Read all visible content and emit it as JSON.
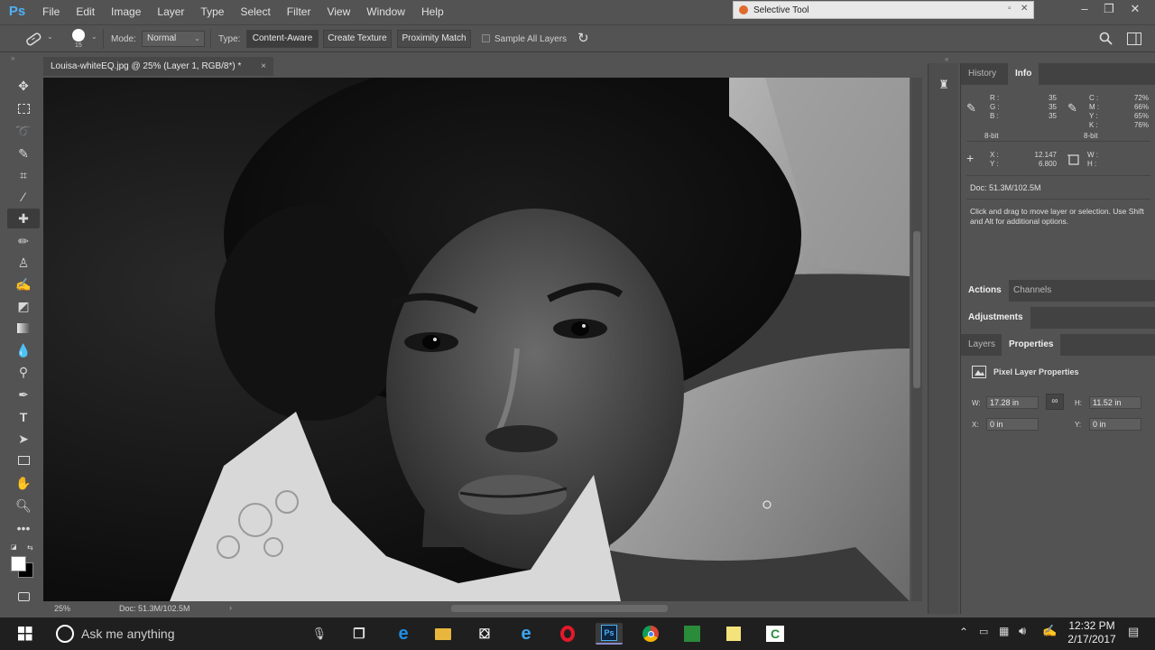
{
  "app": {
    "logo": "Ps"
  },
  "menu": [
    "File",
    "Edit",
    "Image",
    "Layer",
    "Type",
    "Select",
    "Filter",
    "View",
    "Window",
    "Help"
  ],
  "popup": {
    "title": "Selective Tool"
  },
  "options": {
    "brush_size": "15",
    "mode_label": "Mode:",
    "mode_value": "Normal",
    "type_label": "Type:",
    "type_buttons": [
      "Content-Aware",
      "Create Texture",
      "Proximity Match"
    ],
    "sample_all_layers": "Sample All Layers"
  },
  "document": {
    "tab_title": "Louisa-whiteEQ.jpg @ 25% (Layer 1, RGB/8*) *",
    "zoom": "25%",
    "doc_size": "Doc: 51.3M/102.5M"
  },
  "info_panel": {
    "tabs": [
      "History",
      "Info"
    ],
    "rgb_labels": [
      "R :",
      "G :",
      "B :"
    ],
    "rgb_values": [
      "35",
      "35",
      "35"
    ],
    "cmyk_labels": [
      "C :",
      "M :",
      "Y :",
      "K :"
    ],
    "cmyk_values": [
      "72%",
      "66%",
      "65%",
      "76%"
    ],
    "bit_depth": "8-bit",
    "bit_depth_2": "8-bit",
    "x_label": "X :",
    "y_label": "Y :",
    "x_value": "12.147",
    "y_value": "6.800",
    "w_label": "W :",
    "h_label": "H :",
    "doc_size": "Doc: 51.3M/102.5M",
    "hint": "Click and drag to move layer or selection. Use Shift and Alt for additional options."
  },
  "actions_panel": {
    "tabs": [
      "Actions",
      "Channels"
    ]
  },
  "adjustments_panel": {
    "tabs": [
      "Adjustments"
    ]
  },
  "properties_panel": {
    "tabs": [
      "Layers",
      "Properties"
    ],
    "title": "Pixel Layer Properties",
    "w_label": "W:",
    "w_value": "17.28 in",
    "h_label": "H:",
    "h_value": "11.52 in",
    "x_label": "X:",
    "x_value": "0 in",
    "y_label": "Y:",
    "y_value": "0 in"
  },
  "taskbar": {
    "search_placeholder": "Ask me anything",
    "time": "12:32 PM",
    "date": "2/17/2017"
  },
  "colors": {
    "ps_blue": "#4fb0f5",
    "panel_bg": "#535353",
    "taskbar_bg": "#1f1f1f"
  }
}
